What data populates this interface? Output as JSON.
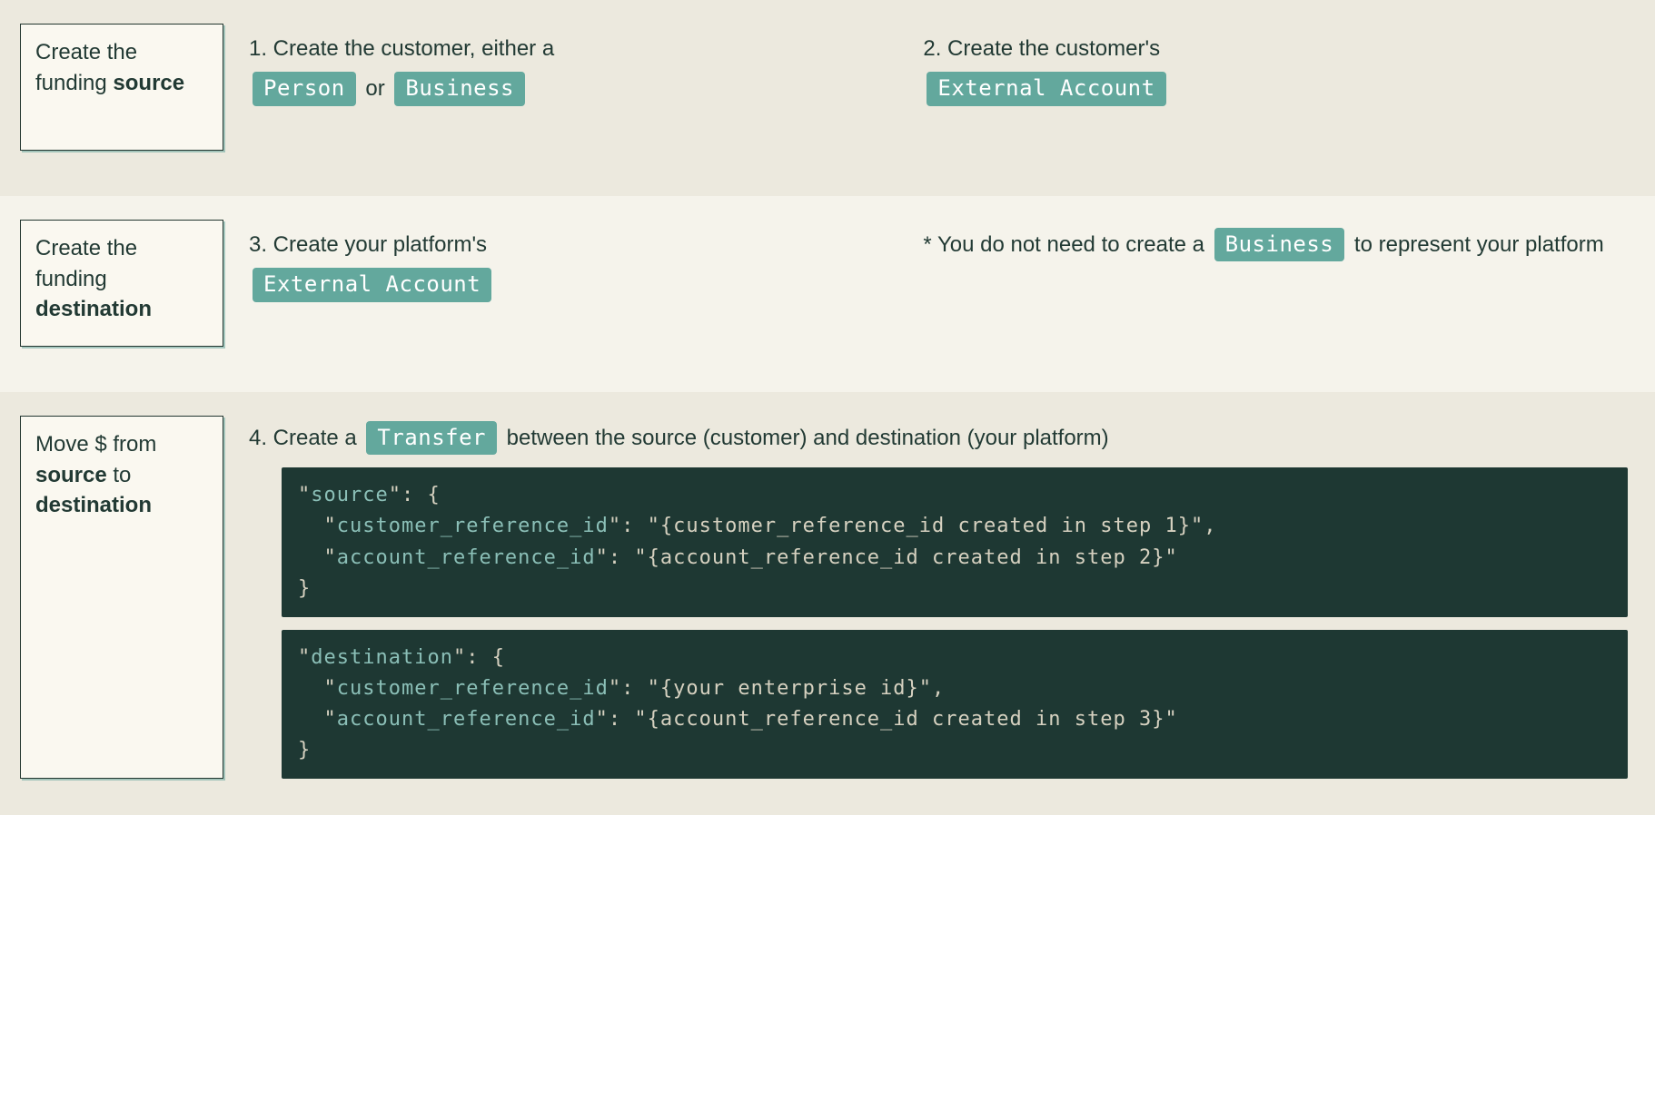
{
  "row1": {
    "card_pre": "Create the funding ",
    "card_bold": "source",
    "left_pre": "1. Create the customer, either a",
    "pill_person": "Person",
    "left_mid": " or ",
    "pill_business": "Business",
    "right_pre": "2. Create the customer's",
    "pill_ext_acct": "External Account"
  },
  "row2": {
    "card_pre": "Create the funding ",
    "card_bold": "destination",
    "left_pre": "3. Create your platform's",
    "pill_ext_acct": "External Account",
    "right_pre": "* You do not need to create a",
    "pill_business": "Business",
    "right_post": " to represent your platform"
  },
  "row3": {
    "card_line1": "Move $ from ",
    "card_bold1": "source",
    "card_mid": " to ",
    "card_bold2": "destination",
    "step_pre": "4. Create a ",
    "pill_transfer": "Transfer",
    "step_post": " between the source (customer) and destination (your platform)",
    "code_source": "\"source\": {\n  \"customer_reference_id\": \"{customer_reference_id created in step 1}\",\n  \"account_reference_id\": \"{account_reference_id created in step 2}\"\n}",
    "code_destination": "\"destination\": {\n  \"customer_reference_id\": \"{your enterprise id}\",\n  \"account_reference_id\": \"{account_reference_id created in step 3}\"\n}"
  }
}
